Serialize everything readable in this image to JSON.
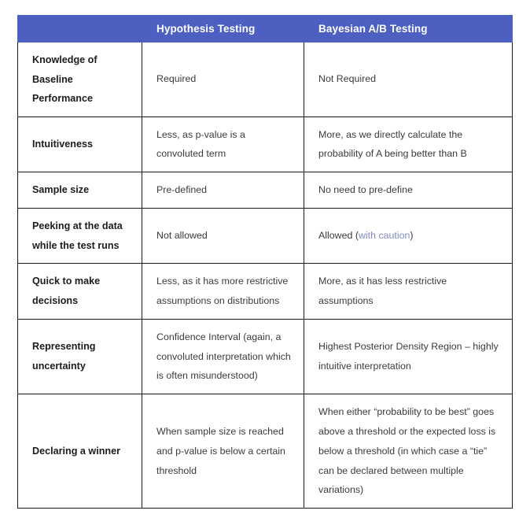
{
  "table": {
    "columns": [
      {
        "label": "",
        "key": "criterion"
      },
      {
        "label": "Hypothesis Testing",
        "key": "hypothesis"
      },
      {
        "label": "Bayesian A/B Testing",
        "key": "bayesian"
      }
    ],
    "header_bg": "#4d5fc1",
    "header_text_color": "#ffffff",
    "border_color": "#1a1a1a",
    "link_color": "#7f8bc4",
    "rows": [
      {
        "criterion": "Knowledge of Baseline Performance",
        "hypothesis": "Required",
        "bayesian": "Not Required"
      },
      {
        "criterion": "Intuitiveness",
        "hypothesis": "Less, as p-value is a convoluted term",
        "bayesian": "More, as we directly calculate the probability of A being better than B"
      },
      {
        "criterion": "Sample size",
        "hypothesis": "Pre-defined",
        "bayesian": "No need to pre-define"
      },
      {
        "criterion": "Peeking at the data while the test runs",
        "hypothesis": "Not allowed",
        "bayesian_prefix": "Allowed (",
        "bayesian_link": "with caution",
        "bayesian_suffix": ")"
      },
      {
        "criterion": "Quick to make decisions",
        "hypothesis": "Less, as it has more restrictive assumptions on distributions",
        "bayesian": "More, as it has less restrictive assumptions"
      },
      {
        "criterion": "Representing uncertainty",
        "hypothesis": "Confidence Interval (again, a convoluted interpretation which is often misunderstood)",
        "bayesian": "Highest Posterior Density Region – highly intuitive interpretation"
      },
      {
        "criterion": "Declaring a winner",
        "hypothesis": "When sample size is reached and p-value is below a certain threshold",
        "bayesian": "When either “probability to be best” goes above a threshold or the expected loss is below a threshold (in which case a “tie” can be declared between multiple variations)"
      }
    ]
  }
}
